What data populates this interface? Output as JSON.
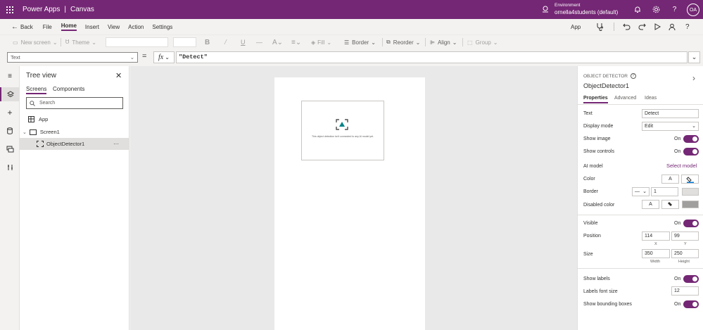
{
  "titlebar": {
    "product": "Power Apps",
    "separator": "|",
    "mode": "Canvas",
    "environment_label": "Environment",
    "environment_name": "ornella4students (default)",
    "avatar_initials": "OA",
    "bg_color": "#742774"
  },
  "commands": {
    "back": "Back",
    "file": "File",
    "home": "Home",
    "insert": "Insert",
    "view": "View",
    "action": "Action",
    "settings": "Settings",
    "app": "App"
  },
  "ribbon": {
    "new_screen": "New screen",
    "theme": "Theme",
    "bold": "B",
    "fill": "Fill",
    "border": "Border",
    "reorder": "Reorder",
    "align": "Align",
    "group": "Group"
  },
  "formula": {
    "property": "Text",
    "equals": "=",
    "fx": "fx",
    "value": "\"Detect\""
  },
  "tree": {
    "title": "Tree view",
    "tab_screens": "Screens",
    "tab_components": "Components",
    "search_placeholder": "Search",
    "app_label": "App",
    "screen_label": "Screen1",
    "control_label": "ObjectDetector1",
    "more": "···"
  },
  "canvas": {
    "detector_message": "This object detection isn't connected to any AI model yet."
  },
  "properties": {
    "type_label": "OBJECT DETECTOR",
    "control_name": "ObjectDetector1",
    "tabs": [
      "Properties",
      "Advanced",
      "Ideas"
    ],
    "text_label": "Text",
    "text_value": "Detect",
    "display_mode_label": "Display mode",
    "display_mode_value": "Edit",
    "show_image_label": "Show image",
    "show_image_state": "On",
    "show_controls_label": "Show controls",
    "show_controls_state": "On",
    "ai_model_label": "AI model",
    "select_model": "Select model",
    "color_label": "Color",
    "border_label": "Border",
    "border_width": "1",
    "disabled_color_label": "Disabled color",
    "visible_label": "Visible",
    "visible_state": "On",
    "position_label": "Position",
    "position_x": "114",
    "position_y": "99",
    "x_label": "X",
    "y_label": "Y",
    "size_label": "Size",
    "size_width": "350",
    "size_height": "250",
    "width_label": "Width",
    "height_label": "Height",
    "show_labels_label": "Show labels",
    "show_labels_state": "On",
    "labels_font_size_label": "Labels font size",
    "labels_font_size_value": "12",
    "show_bounding_boxes_label": "Show bounding boxes",
    "show_bounding_boxes_state": "On",
    "accent_color": "#742774"
  }
}
